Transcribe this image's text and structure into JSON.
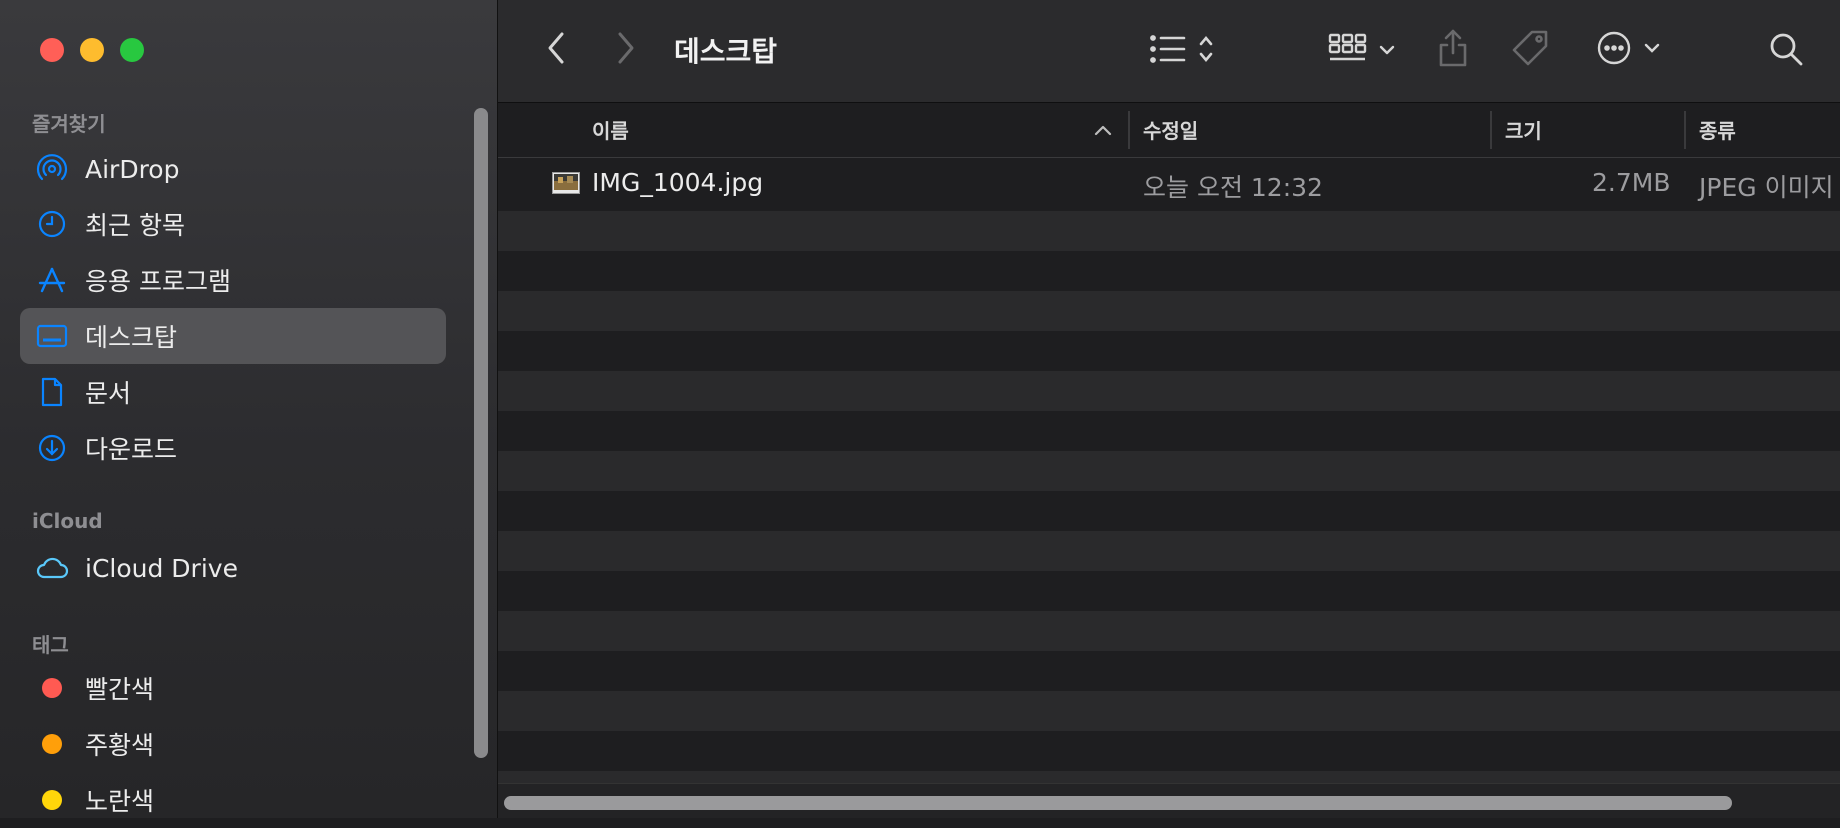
{
  "window": {
    "title": "데스크탑"
  },
  "sidebar": {
    "favorites_label": "즐겨찾기",
    "favorites": [
      {
        "label": "AirDrop",
        "icon": "airdrop-icon"
      },
      {
        "label": "최근 항목",
        "icon": "clock-icon"
      },
      {
        "label": "응용 프로그램",
        "icon": "apps-icon"
      },
      {
        "label": "데스크탑",
        "icon": "desktop-icon",
        "selected": true
      },
      {
        "label": "문서",
        "icon": "document-icon"
      },
      {
        "label": "다운로드",
        "icon": "download-icon"
      }
    ],
    "icloud_label": "iCloud",
    "icloud": [
      {
        "label": "iCloud Drive",
        "icon": "cloud-icon"
      }
    ],
    "tags_label": "태그",
    "tags": [
      {
        "label": "빨간색",
        "color": "#ff5a52"
      },
      {
        "label": "주황색",
        "color": "#ff9f0a"
      },
      {
        "label": "노란색",
        "color": "#ffd60a"
      }
    ]
  },
  "columns": {
    "name": "이름",
    "modified": "수정일",
    "size": "크기",
    "kind": "종류"
  },
  "files": [
    {
      "name": "IMG_1004.jpg",
      "modified": "오늘 오전 12:32",
      "size": "2.7MB",
      "kind": "JPEG 이미지"
    }
  ],
  "colors": {
    "accent": "#0a84ff",
    "selected_bg": "#545457"
  }
}
